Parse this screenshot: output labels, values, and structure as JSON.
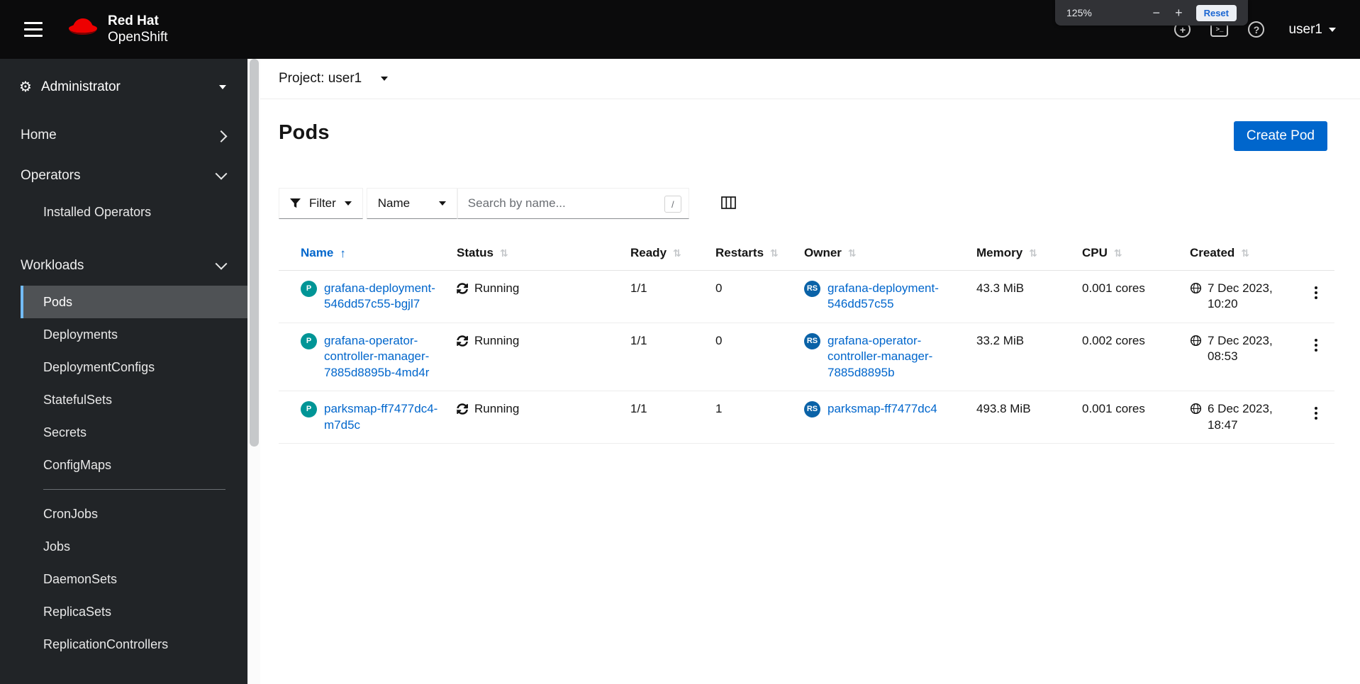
{
  "masthead": {
    "brand_line1": "Red Hat",
    "brand_line2": "OpenShift",
    "user": "user1"
  },
  "zoom_popup": {
    "level": "125%",
    "minus": "−",
    "plus": "+",
    "reset": "Reset"
  },
  "sidebar": {
    "perspective": "Administrator",
    "home": "Home",
    "operators": {
      "label": "Operators",
      "items": [
        "Installed Operators"
      ]
    },
    "workloads": {
      "label": "Workloads",
      "active": "Pods",
      "group1": [
        "Pods",
        "Deployments",
        "DeploymentConfigs",
        "StatefulSets",
        "Secrets",
        "ConfigMaps"
      ],
      "group2": [
        "CronJobs",
        "Jobs",
        "DaemonSets",
        "ReplicaSets",
        "ReplicationControllers"
      ]
    }
  },
  "project_bar": {
    "label": "Project: user1"
  },
  "page": {
    "title": "Pods",
    "create_button": "Create Pod"
  },
  "toolbar": {
    "filter": "Filter",
    "attribute": "Name",
    "search_placeholder": "Search by name...",
    "shortcut_hint": "/"
  },
  "table": {
    "columns": [
      {
        "label": "Name",
        "sort": "asc"
      },
      {
        "label": "Status",
        "sort": "none"
      },
      {
        "label": "Ready",
        "sort": "none"
      },
      {
        "label": "Restarts",
        "sort": "none"
      },
      {
        "label": "Owner",
        "sort": "none"
      },
      {
        "label": "Memory",
        "sort": "none"
      },
      {
        "label": "CPU",
        "sort": "none"
      },
      {
        "label": "Created",
        "sort": "none"
      }
    ],
    "rows": [
      {
        "badge": "P",
        "name": "grafana-deployment-546dd57c55-bgjl7",
        "status": "Running",
        "ready": "1/1",
        "restarts": "0",
        "owner_badge": "RS",
        "owner": "grafana-deployment-546dd57c55",
        "memory": "43.3 MiB",
        "cpu": "0.001 cores",
        "created": "7 Dec 2023, 10:20"
      },
      {
        "badge": "P",
        "name": "grafana-operator-controller-manager-7885d8895b-4md4r",
        "status": "Running",
        "ready": "1/1",
        "restarts": "0",
        "owner_badge": "RS",
        "owner": "grafana-operator-controller-manager-7885d8895b",
        "memory": "33.2 MiB",
        "cpu": "0.002 cores",
        "created": "7 Dec 2023, 08:53"
      },
      {
        "badge": "P",
        "name": "parksmap-ff7477dc4-m7d5c",
        "status": "Running",
        "ready": "1/1",
        "restarts": "1",
        "owner_badge": "RS",
        "owner": "parksmap-ff7477dc4",
        "memory": "493.8 MiB",
        "cpu": "0.001 cores",
        "created": "6 Dec 2023, 18:47"
      }
    ]
  }
}
